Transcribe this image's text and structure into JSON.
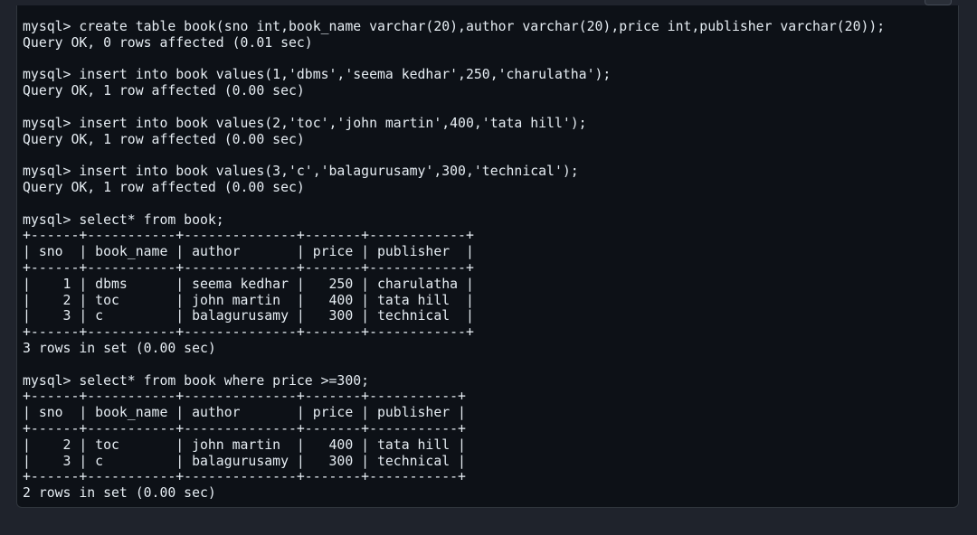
{
  "terminal": {
    "lines": [
      "mysql> create table book(sno int,book_name varchar(20),author varchar(20),price int,publisher varchar(20));",
      "Query OK, 0 rows affected (0.01 sec)",
      "",
      "mysql> insert into book values(1,'dbms','seema kedhar',250,'charulatha');",
      "Query OK, 1 row affected (0.00 sec)",
      "",
      "mysql> insert into book values(2,'toc','john martin',400,'tata hill');",
      "Query OK, 1 row affected (0.00 sec)",
      "",
      "mysql> insert into book values(3,'c','balagurusamy',300,'technical');",
      "Query OK, 1 row affected (0.00 sec)",
      "",
      "mysql> select* from book;",
      "+------+-----------+--------------+-------+------------+",
      "| sno  | book_name | author       | price | publisher  |",
      "+------+-----------+--------------+-------+------------+",
      "|    1 | dbms      | seema kedhar |   250 | charulatha |",
      "|    2 | toc       | john martin  |   400 | tata hill  |",
      "|    3 | c         | balagurusamy |   300 | technical  |",
      "+------+-----------+--------------+-------+------------+",
      "3 rows in set (0.00 sec)",
      "",
      "mysql> select* from book where price >=300;",
      "+------+-----------+--------------+-------+-----------+",
      "| sno  | book_name | author       | price | publisher |",
      "+------+-----------+--------------+-------+-----------+",
      "|    2 | toc       | john martin  |   400 | tata hill |",
      "|    3 | c         | balagurusamy |   300 | technical |",
      "+------+-----------+--------------+-------+-----------+",
      "2 rows in set (0.00 sec)"
    ]
  },
  "colors": {
    "terminal_background": "#0d1117",
    "text": "#e6edf3",
    "page_background": "#1f232c"
  }
}
